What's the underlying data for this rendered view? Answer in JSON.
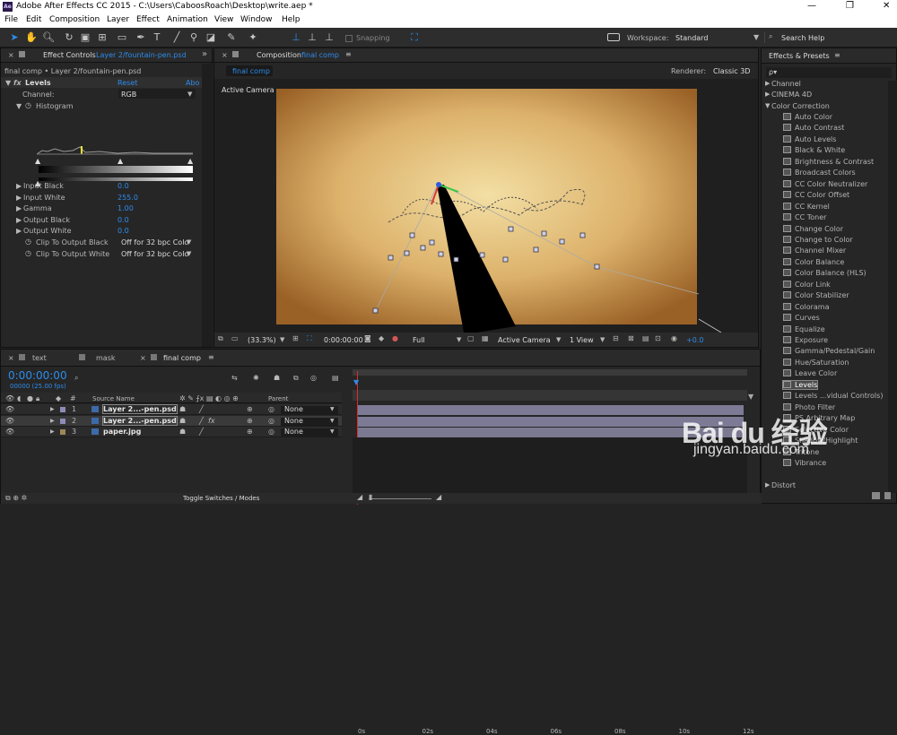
{
  "window": {
    "title": "Adobe After Effects CC 2015 - C:\\Users\\CaboosRoach\\Desktop\\write.aep *",
    "logo": "Ae",
    "minimize": "—",
    "maximize": "❐",
    "close": "✕"
  },
  "menu": [
    "File",
    "Edit",
    "Composition",
    "Layer",
    "Effect",
    "Animation",
    "View",
    "Window",
    "Help"
  ],
  "toolbar": {
    "snapping": "Snapping",
    "workspace_label": "Workspace:",
    "workspace_value": "Standard",
    "search_help": "Search Help"
  },
  "effect_controls": {
    "tab": "Effect Controls",
    "tab_layer": "Layer 2/fountain-pen.psd",
    "breadcrumb": "final comp • Layer 2/fountain-pen.psd",
    "effect_name": "Levels",
    "reset": "Reset",
    "about": "Abo",
    "channel_label": "Channel:",
    "channel_value": "RGB",
    "histogram": "Histogram",
    "params": [
      {
        "label": "Input Black",
        "value": "0.0"
      },
      {
        "label": "Input White",
        "value": "255.0"
      },
      {
        "label": "Gamma",
        "value": "1.00"
      },
      {
        "label": "Output Black",
        "value": "0.0"
      },
      {
        "label": "Output White",
        "value": "0.0"
      }
    ],
    "clips": [
      {
        "label": "Clip To Output Black",
        "value": "Off for 32 bpc Colo"
      },
      {
        "label": "Clip To Output White",
        "value": "Off for 32 bpc Colo"
      }
    ]
  },
  "composition": {
    "tab": "Composition",
    "tab_name": "final comp",
    "subtab": "final comp",
    "renderer_label": "Renderer:",
    "renderer_value": "Classic 3D",
    "camera_label": "Active Camera",
    "footer": {
      "zoom": "(33.3%)",
      "timecode": "0:00:00:00",
      "resolution": "Full",
      "view": "Active Camera",
      "views": "1 View",
      "exposure": "+0.0"
    }
  },
  "effects_presets": {
    "title": "Effects & Presets",
    "search_placeholder": "ρ▾",
    "categories_before": [
      "Channel",
      "CINEMA 4D"
    ],
    "open_category": "Color Correction",
    "items": [
      "Auto Color",
      "Auto Contrast",
      "Auto Levels",
      "Black & White",
      "Brightness & Contrast",
      "Broadcast Colors",
      "CC Color Neutralizer",
      "CC Color Offset",
      "CC Kernel",
      "CC Toner",
      "Change Color",
      "Change to Color",
      "Channel Mixer",
      "Color Balance",
      "Color Balance (HLS)",
      "Color Link",
      "Color Stabilizer",
      "Colorama",
      "Curves",
      "Equalize",
      "Exposure",
      "Gamma/Pedestal/Gain",
      "Hue/Saturation",
      "Leave Color",
      "Levels",
      "Levels ...vidual Controls)",
      "Photo Filter",
      "PS Arbitrary Map",
      "Selective Color",
      "Shadow/Highlight",
      "Tritone",
      "Vibrance"
    ],
    "selected": "Levels",
    "categories_after": [
      "Distort"
    ]
  },
  "timeline": {
    "tabs": [
      "text",
      "mask",
      "final comp"
    ],
    "timecode": "0:00:00:00",
    "fps": "00000 (25.00 fps)",
    "col_source": "Source Name",
    "col_parent": "Parent",
    "ruler": [
      "0s",
      "02s",
      "04s",
      "06s",
      "08s",
      "10s",
      "12s"
    ],
    "layers": [
      {
        "num": "1",
        "name": "Layer 2...-pen.psd",
        "parent": "None"
      },
      {
        "num": "2",
        "name": "Layer 2...-pen.psd",
        "parent": "None"
      },
      {
        "num": "3",
        "name": "paper.jpg",
        "parent": "None"
      }
    ],
    "toggle": "Toggle Switches / Modes"
  },
  "watermark": {
    "brand": "Bai du 经验",
    "url": "jingyan.baidu.com"
  }
}
